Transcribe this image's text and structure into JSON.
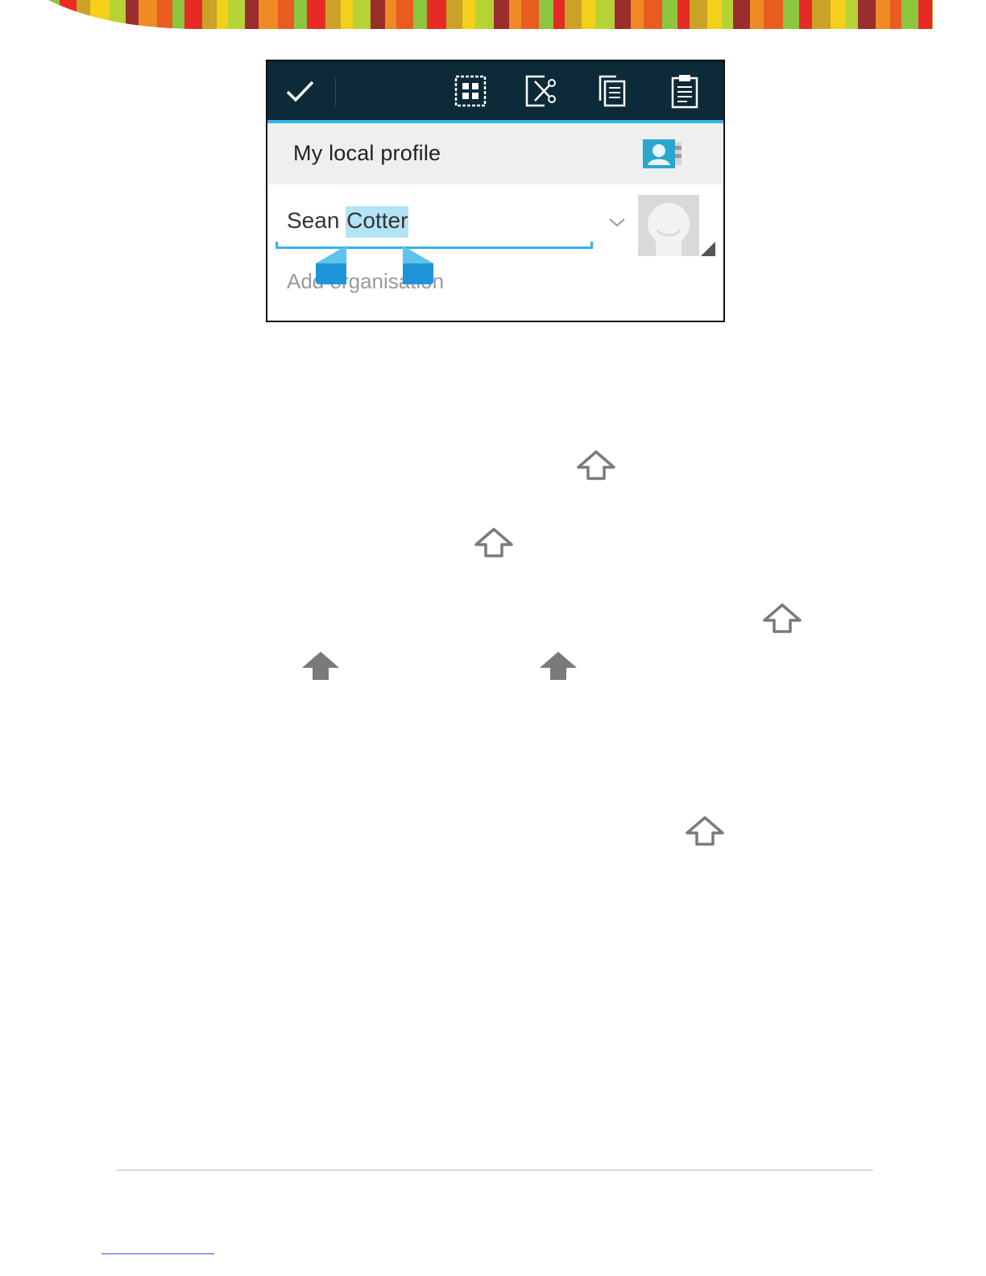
{
  "banner": {
    "colors": [
      "#e62b25",
      "#f08a24",
      "#f4d01a",
      "#8cc63f",
      "#9b2d2d",
      "#c9a227",
      "#e85d1f",
      "#b5d334"
    ]
  },
  "actionbar": {
    "done_icon": "checkmark-icon",
    "buttons": [
      "select-all-icon",
      "cut-icon",
      "copy-icon",
      "paste-icon"
    ],
    "accent": "#33b5e5",
    "background": "#0d2a38"
  },
  "profile": {
    "header_title": "My local profile",
    "header_icon": "contact-card-icon",
    "name_unselected": "Sean ",
    "name_selected": "Cotter",
    "org_placeholder": "Add organisation"
  },
  "arrows": {
    "outline": "outline-up-arrow-icon",
    "filled": "filled-up-arrow-icon",
    "color": "#7a7a7a"
  }
}
